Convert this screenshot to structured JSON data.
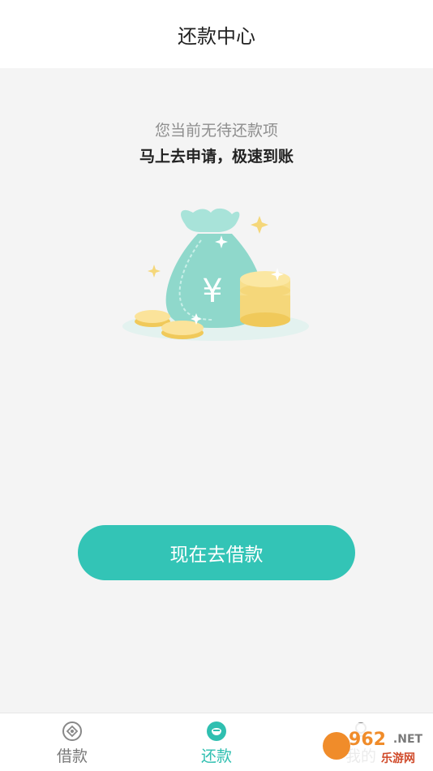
{
  "header": {
    "title": "还款中心"
  },
  "empty_state": {
    "title": "您当前无待还款项",
    "subtitle": "马上去申请，极速到账",
    "illustration_icon": "money-bag-coins-icon",
    "currency_symbol": "¥"
  },
  "cta": {
    "label": "现在去借款",
    "color": "#33c4b6"
  },
  "tabbar": {
    "accent": "#2fbfb0",
    "items": [
      {
        "label": "借款",
        "icon": "loan-icon"
      },
      {
        "label": "还款",
        "icon": "repay-icon",
        "active": true
      },
      {
        "label": "我的",
        "icon": "profile-icon"
      }
    ]
  },
  "watermark": {
    "brand": "962",
    "suffix": ".NET",
    "caption": "乐游网"
  }
}
